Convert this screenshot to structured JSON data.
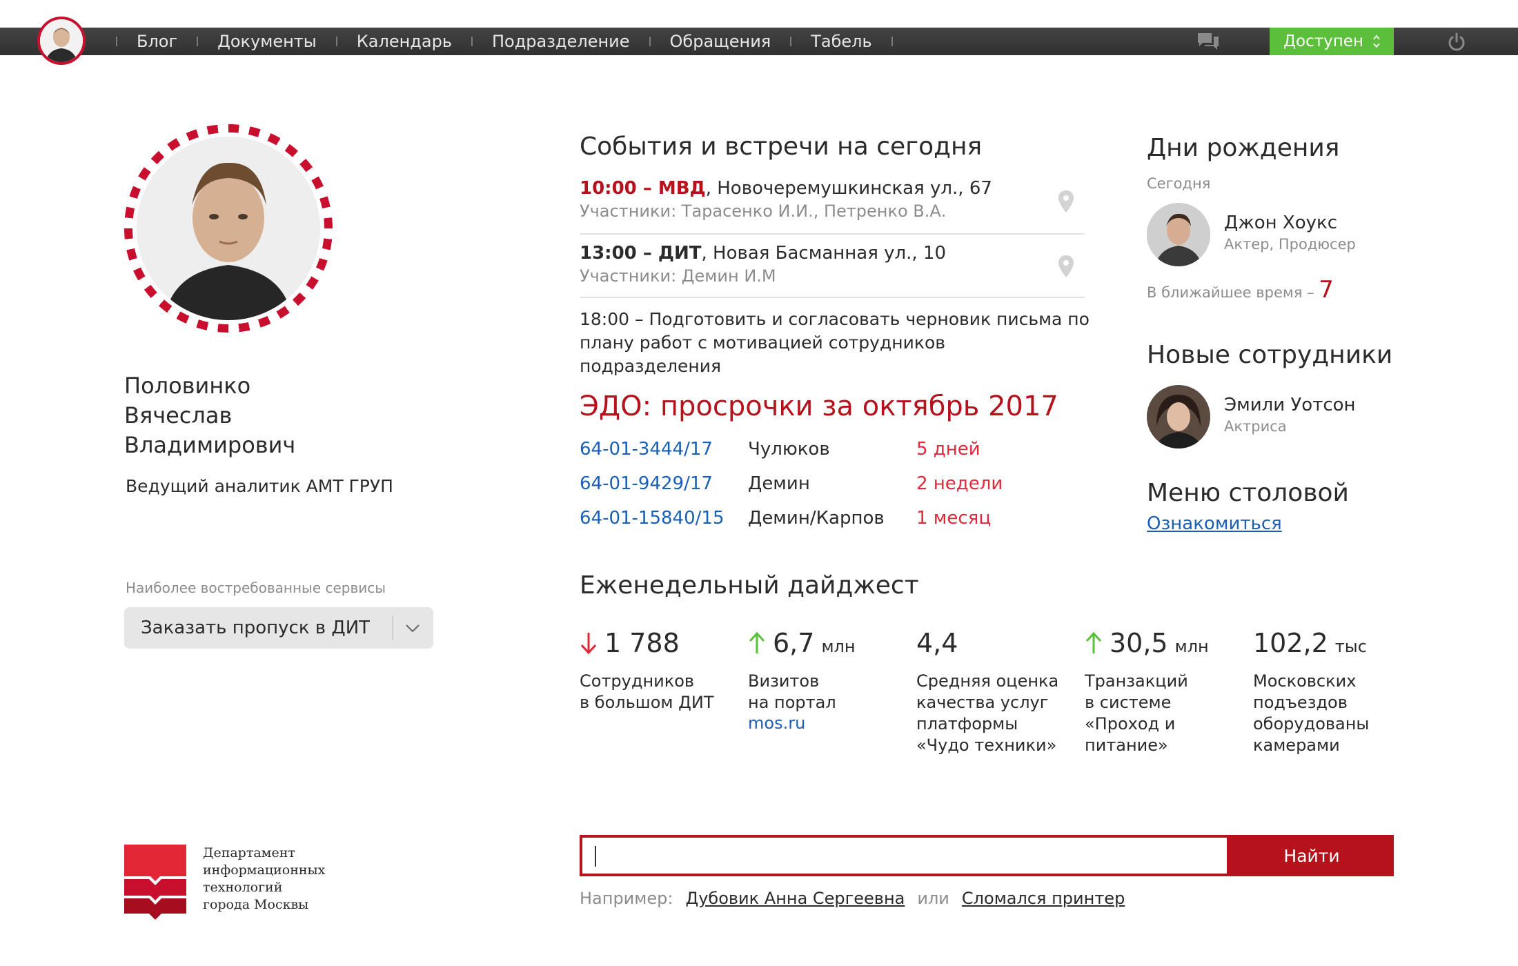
{
  "nav": {
    "items": [
      "Блог",
      "Документы",
      "Календарь",
      "Подразделение",
      "Обращения",
      "Табель"
    ]
  },
  "status": {
    "label": "Доступен"
  },
  "profile": {
    "name": "Половинко\nВячеслав\nВладимирович",
    "role": "Ведущий аналитик АМТ ГРУП"
  },
  "services": {
    "label": "Наиболее востребованные сервисы",
    "selected": "Заказать пропуск в ДИТ"
  },
  "events": {
    "title": "События и встречи на сегодня",
    "items": [
      {
        "time": "10:00 – МВД",
        "address": ", Новочеремушкинская ул., 67",
        "participants": "Участники: Тарасенко И.И., Петренко В.А."
      },
      {
        "time": "13:00 – ДИТ",
        "address": ", Новая Басманная ул., 10",
        "participants": "Участники: Демин И.М"
      }
    ],
    "task": "18:00 – Подготовить и согласовать черновик письма по плану работ с мотивацией сотрудников подразделения"
  },
  "edo": {
    "title": "ЭДО: просрочки за октябрь 2017",
    "rows": [
      {
        "doc": "64-01-3444/17",
        "person": "Чулюков",
        "delay": "5 дней"
      },
      {
        "doc": "64-01-9429/17",
        "person": "Демин",
        "delay": "2 недели"
      },
      {
        "doc": "64-01-15840/15",
        "person": "Демин/Карпов",
        "delay": "1 месяц"
      }
    ]
  },
  "digest": {
    "title": "Еженедельный дайджест",
    "items": [
      {
        "trend": "down",
        "value": "1 788",
        "unit": "",
        "label": "Сотрудников\nв большом ДИТ",
        "link": ""
      },
      {
        "trend": "up",
        "value": "6,7",
        "unit": "млн",
        "label": "Визитов\nна портал",
        "link": "mos.ru"
      },
      {
        "trend": "none",
        "value": "4,4",
        "unit": "",
        "label": "Средняя оценка\nкачества услуг\nплатформы\n«Чудо техники»",
        "link": ""
      },
      {
        "trend": "up",
        "value": "30,5",
        "unit": "млн",
        "label": "Транзакций\nв системе\n«Проход и\nпитание»",
        "link": ""
      },
      {
        "trend": "none",
        "value": "102,2",
        "unit": "тыс",
        "label": "Московских\nподъездов\nоборудованы\nкамерами",
        "link": ""
      }
    ]
  },
  "birthdays": {
    "title": "Дни рождения",
    "today_label": "Сегодня",
    "person_name": "Джон Хоукс",
    "person_role": "Актер, Продюсер",
    "upcoming_label": "В ближайшее время –",
    "upcoming_count": "7"
  },
  "new_employees": {
    "title": "Новые сотрудники",
    "person_name": "Эмили Уотсон",
    "person_role": "Актриса"
  },
  "canteen": {
    "title": "Меню столовой",
    "link": "Ознакомиться"
  },
  "footer": {
    "logo_text": "Департамент\nинформационных\nтехнологий\nгорода Москвы"
  },
  "search": {
    "button": "Найти",
    "example_label": "Например:",
    "example_1": "Дубовик Анна Сергеевна",
    "or": "или",
    "example_2": "Сломался принтер"
  },
  "colors": {
    "accent": "#b5121b",
    "link": "#1a5fb4",
    "status_green": "#5cbf3c",
    "topbar": "#333333"
  }
}
